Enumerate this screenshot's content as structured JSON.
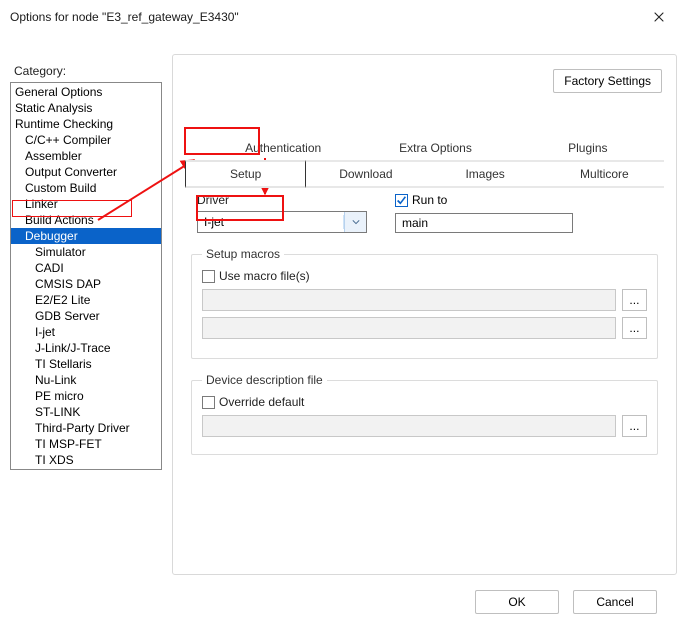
{
  "window": {
    "title": "Options for node \"E3_ref_gateway_E3430\""
  },
  "category_label": "Category:",
  "categories": [
    {
      "label": "General Options",
      "indent": false
    },
    {
      "label": "Static Analysis",
      "indent": false
    },
    {
      "label": "Runtime Checking",
      "indent": false
    },
    {
      "label": "C/C++ Compiler",
      "indent": true
    },
    {
      "label": "Assembler",
      "indent": true
    },
    {
      "label": "Output Converter",
      "indent": true
    },
    {
      "label": "Custom Build",
      "indent": true
    },
    {
      "label": "Linker",
      "indent": true
    },
    {
      "label": "Build Actions",
      "indent": true
    },
    {
      "label": "Debugger",
      "indent": true,
      "selected": true
    },
    {
      "label": "Simulator",
      "indent": true,
      "sub": true
    },
    {
      "label": "CADI",
      "indent": true,
      "sub": true
    },
    {
      "label": "CMSIS DAP",
      "indent": true,
      "sub": true
    },
    {
      "label": "E2/E2 Lite",
      "indent": true,
      "sub": true
    },
    {
      "label": "GDB Server",
      "indent": true,
      "sub": true
    },
    {
      "label": "I-jet",
      "indent": true,
      "sub": true
    },
    {
      "label": "J-Link/J-Trace",
      "indent": true,
      "sub": true
    },
    {
      "label": "TI Stellaris",
      "indent": true,
      "sub": true
    },
    {
      "label": "Nu-Link",
      "indent": true,
      "sub": true
    },
    {
      "label": "PE micro",
      "indent": true,
      "sub": true
    },
    {
      "label": "ST-LINK",
      "indent": true,
      "sub": true
    },
    {
      "label": "Third-Party Driver",
      "indent": true,
      "sub": true
    },
    {
      "label": "TI MSP-FET",
      "indent": true,
      "sub": true
    },
    {
      "label": "TI XDS",
      "indent": true,
      "sub": true
    }
  ],
  "factory_settings_label": "Factory Settings",
  "tabs_top": [
    {
      "label": "Authentication"
    },
    {
      "label": "Extra Options"
    },
    {
      "label": "Plugins"
    }
  ],
  "tabs_bottom": [
    {
      "label": "Setup",
      "active": true
    },
    {
      "label": "Download"
    },
    {
      "label": "Images"
    },
    {
      "label": "Multicore"
    }
  ],
  "driver": {
    "label": "Driver",
    "value": "I-jet"
  },
  "run_to": {
    "label": "Run to",
    "checked": true,
    "value": "main"
  },
  "setup_macros": {
    "legend": "Setup macros",
    "use_macro_label": "Use macro file(s)",
    "use_macro_checked": false,
    "file1": "",
    "file2": "",
    "browse": "..."
  },
  "device_desc": {
    "legend": "Device description file",
    "override_label": "Override default",
    "override_checked": false,
    "file": "",
    "browse": "..."
  },
  "buttons": {
    "ok": "OK",
    "cancel": "Cancel"
  }
}
